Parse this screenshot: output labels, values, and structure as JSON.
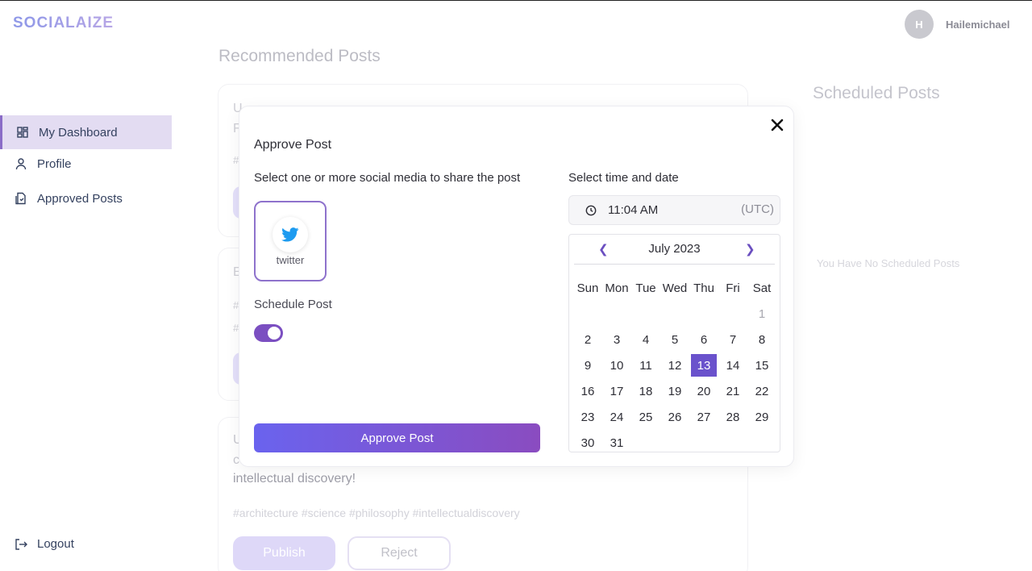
{
  "app": {
    "logo": "SOCIALAIZE"
  },
  "user": {
    "initial": "H",
    "name": "Hailemichael"
  },
  "sidebar": {
    "items": [
      {
        "label": "My Dashboard",
        "icon": "dashboard-icon"
      },
      {
        "label": "Profile",
        "icon": "user-icon"
      },
      {
        "label": "Approved Posts",
        "icon": "document-icon"
      }
    ],
    "logout": "Logout"
  },
  "main": {
    "title": "Recommended Posts",
    "post3": {
      "line_a": "U",
      "line_b": "c",
      "line_c": "intellectual discovery!",
      "hashtags": "#architecture #science #philosophy #intellectualdiscovery",
      "publish_label": "Publish",
      "reject_label": "Reject"
    },
    "ghost_letters": {
      "p1a": "U",
      "p1b": "F",
      "p1c": "#",
      "p2a": "E",
      "p2b": "#",
      "p2c": "#"
    }
  },
  "scheduled": {
    "title": "Scheduled Posts",
    "empty": "You Have No Scheduled Posts"
  },
  "modal": {
    "title": "Approve Post",
    "social_label": "Select one or more social media to share the post",
    "platforms": [
      {
        "label": "twitter",
        "icon": "twitter-icon",
        "color": "#1d9bf0"
      }
    ],
    "schedule_label": "Schedule Post",
    "schedule_enabled": true,
    "approve_label": "Approve Post",
    "datetime_label": "Select time and date",
    "time_value": "11:04 AM",
    "timezone": "(UTC)",
    "calendar": {
      "month_label": "July 2023",
      "weekdays": [
        "Sun",
        "Mon",
        "Tue",
        "Wed",
        "Thu",
        "Fri",
        "Sat"
      ],
      "days_leading_blank": 6,
      "days_in_month": 31,
      "selected_day": 13
    }
  }
}
